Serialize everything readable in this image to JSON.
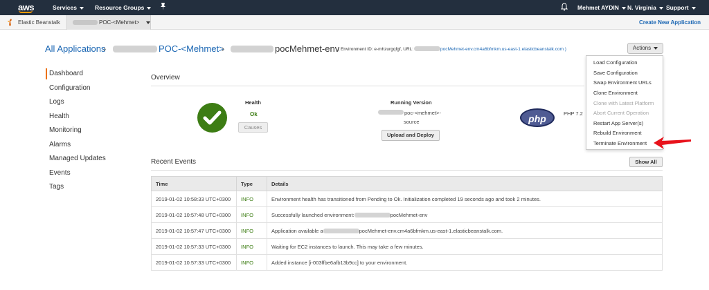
{
  "topnav": {
    "logo": "aws",
    "services": "Services",
    "resource_groups": "Resource Groups",
    "pin_icon": "pin-icon",
    "bell_icon": "bell-icon",
    "user": "Mehmet AYDIN",
    "region": "N. Virginia",
    "support": "Support"
  },
  "subnav": {
    "service": "Elastic Beanstalk",
    "app_tab": "POC-<Mehmet>",
    "create_app": "Create New Application"
  },
  "breadcrumb": {
    "root": "All Applications",
    "app": "POC-<Mehmet>",
    "env": "pocMehmet-env",
    "env_id": "( Environment ID: e-mhzurgqfgf, URL:",
    "env_url": "pocMehmet-env.cm4a6bfmkm.us-east-1.elasticbeanstalk.com )"
  },
  "actions": {
    "label": "Actions",
    "menu": [
      {
        "label": "Load Configuration",
        "enabled": true
      },
      {
        "label": "Save Configuration",
        "enabled": true
      },
      {
        "label": "Swap Environment URLs",
        "enabled": true
      },
      {
        "label": "Clone Environment",
        "enabled": true
      },
      {
        "label": "Clone with Latest Platform",
        "enabled": false
      },
      {
        "label": "Abort Current Operation",
        "enabled": false
      },
      {
        "label": "Restart App Server(s)",
        "enabled": true
      },
      {
        "label": "Rebuild Environment",
        "enabled": true
      },
      {
        "label": "Terminate Environment",
        "enabled": true
      }
    ]
  },
  "sidebar": {
    "items": [
      {
        "label": "Dashboard",
        "active": true
      },
      {
        "label": "Configuration"
      },
      {
        "label": "Logs"
      },
      {
        "label": "Health"
      },
      {
        "label": "Monitoring"
      },
      {
        "label": "Alarms"
      },
      {
        "label": "Managed Updates"
      },
      {
        "label": "Events"
      },
      {
        "label": "Tags"
      }
    ]
  },
  "overview": {
    "title": "Overview",
    "health_label": "Health",
    "health_status": "Ok",
    "causes": "Causes",
    "running_version_label": "Running Version",
    "version_name": "poc-<mehmet>-",
    "version_suffix": "source",
    "upload_deploy": "Upload and Deploy",
    "php_logo": "php",
    "platform": "PHP 7.2"
  },
  "events": {
    "title": "Recent Events",
    "show_all": "Show All",
    "columns": [
      "Time",
      "Type",
      "Details"
    ],
    "rows": [
      {
        "time": "2019-01-02 10:58:33 UTC+0300",
        "type": "INFO",
        "details": "Environment health has transitioned from Pending to Ok. Initialization completed 19 seconds ago and took 2 minutes."
      },
      {
        "time": "2019-01-02 10:57:48 UTC+0300",
        "type": "INFO",
        "details_pre": "Successfully launched environment:",
        "details_post": "pocMehmet-env"
      },
      {
        "time": "2019-01-02 10:57:47 UTC+0300",
        "type": "INFO",
        "details_pre": "Application available a",
        "details_post": "pocMehmet-env.cm4a6bfmkm.us-east-1.elasticbeanstalk.com."
      },
      {
        "time": "2019-01-02 10:57:33 UTC+0300",
        "type": "INFO",
        "details": "Waiting for EC2 instances to launch. This may take a few minutes."
      },
      {
        "time": "2019-01-02 10:57:33 UTC+0300",
        "type": "INFO",
        "details": "Added instance [i-003ffbe6afb13b9cc] to your environment."
      }
    ]
  },
  "colors": {
    "nav_bg": "#232f3e",
    "accent_orange": "#ec7211",
    "link_blue": "#1a66b3",
    "ok_green": "#3d7d14",
    "arrow_red": "#e8121b"
  }
}
